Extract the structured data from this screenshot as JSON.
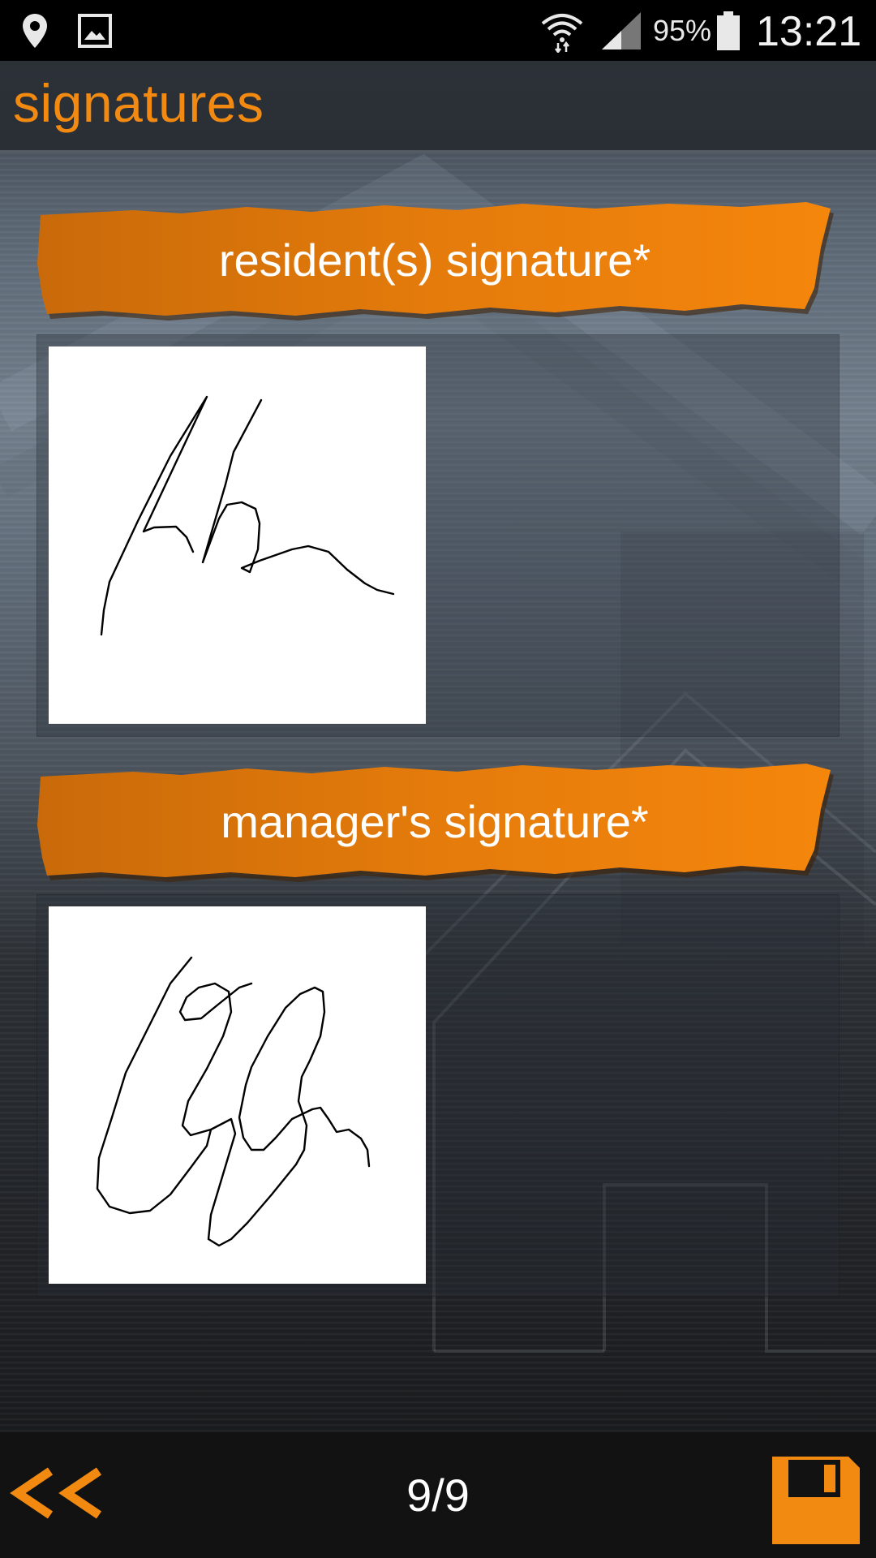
{
  "status_bar": {
    "icons": [
      "location-pin-icon",
      "image-icon",
      "wifi-icon",
      "signal-icon",
      "battery-icon"
    ],
    "battery": "95%",
    "time": "13:21"
  },
  "header": {
    "title": "signatures"
  },
  "sections": [
    {
      "label": "resident(s) signature*"
    },
    {
      "label": "manager's signature*"
    }
  ],
  "footer": {
    "back_icon": "double-chevron-left-icon",
    "page_indicator": "9/9",
    "save_icon": "floppy-disk-icon"
  },
  "colors": {
    "accent": "#f28a12",
    "banner": "#e27a0c",
    "text": "#ffffff"
  }
}
